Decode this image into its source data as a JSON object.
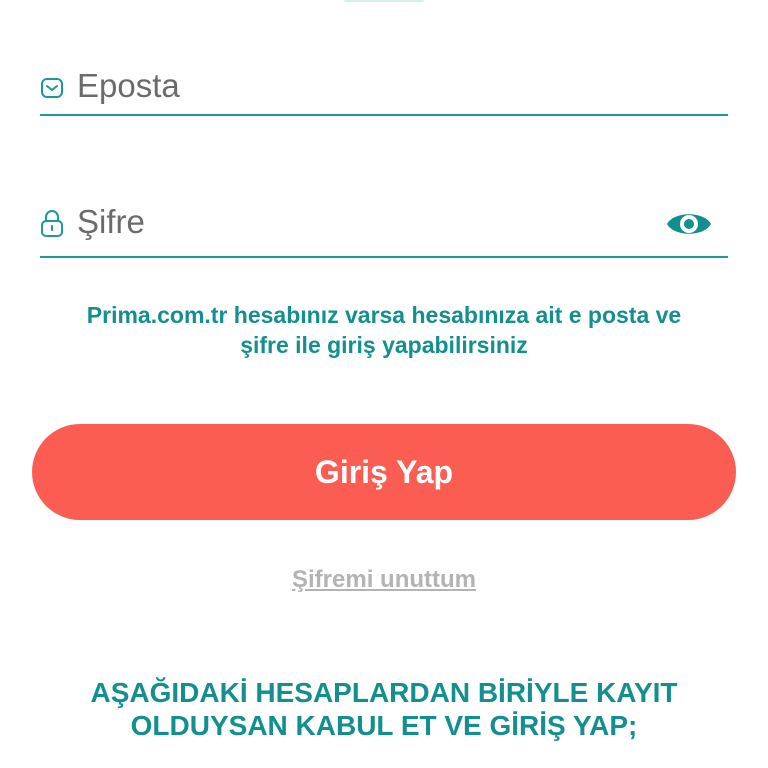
{
  "colors": {
    "teal": "#1a9a9a",
    "teal_text": "#138f8f",
    "button": "#fc5d53",
    "link": "#b3b3b3"
  },
  "login_form": {
    "email": {
      "icon": "mail-icon",
      "placeholder": "Eposta",
      "value": ""
    },
    "password": {
      "icon": "lock-icon",
      "placeholder": "Şifre",
      "value": "",
      "toggle_icon": "eye-icon"
    },
    "info_text_line1": "Prima.com.tr hesabınız varsa hesabınıza ait e posta ve",
    "info_text_line2": "şifre ile giriş yapabilirsiniz",
    "submit_label": "Giriş Yap",
    "forgot_label": "Şifremi unuttum"
  },
  "social": {
    "heading_line1": "AŞAĞIDAKİ HESAPLARDAN BİRİYLE KAYIT",
    "heading_line2": "OLDUYSAN KABUL ET VE GİRİŞ YAP;"
  }
}
